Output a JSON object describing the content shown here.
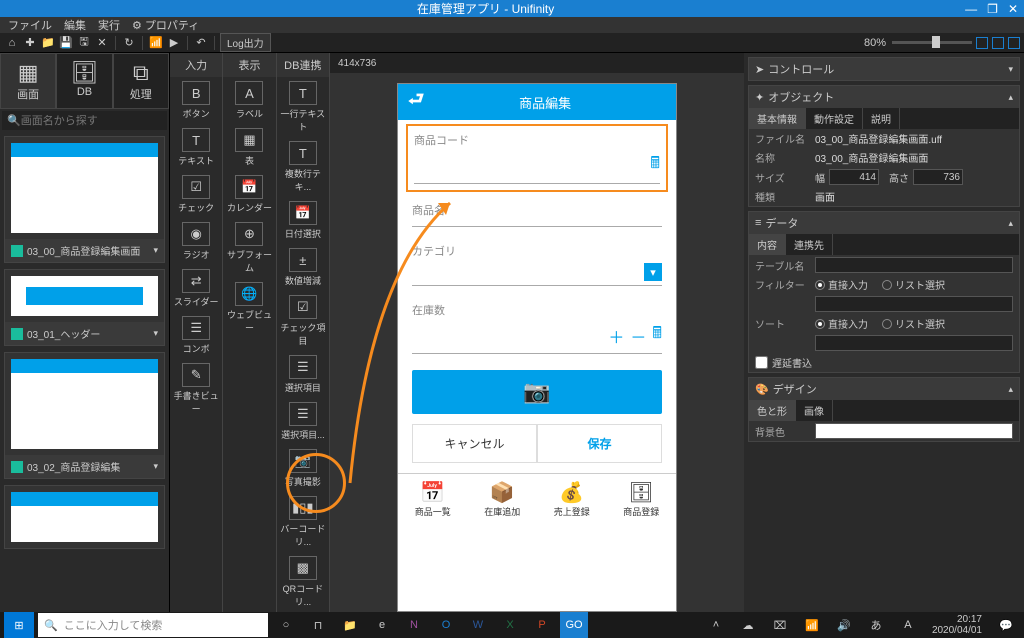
{
  "window": {
    "title": "在庫管理アプリ - Unifinity"
  },
  "menu": {
    "file": "ファイル",
    "edit": "編集",
    "run": "実行",
    "property": "⚙ プロパティ"
  },
  "toolbar": {
    "log": "Log出力",
    "zoom": "80%"
  },
  "left_tabs": {
    "screen": "画面",
    "db": "DB",
    "process": "処理"
  },
  "search": {
    "placeholder": "画面名から探す"
  },
  "thumbs": [
    {
      "label": "03_00_商品登録編集画面"
    },
    {
      "label": "03_01_ヘッダー"
    },
    {
      "label": "03_02_商品登録編集"
    }
  ],
  "palette": {
    "col1": {
      "header": "入力",
      "items": [
        "ボタン",
        "テキスト",
        "チェック",
        "ラジオ",
        "スライダー",
        "コンボ",
        "手書きビュー"
      ]
    },
    "col2": {
      "header": "表示",
      "items": [
        "ラベル",
        "表",
        "カレンダー",
        "サブフォーム",
        "ウェブビュー"
      ]
    },
    "col3": {
      "header": "DB連携",
      "items": [
        "一行テキスト",
        "複数行テキ...",
        "日付選択",
        "数値増減",
        "チェック項目",
        "選択項目",
        "選択項目...",
        "写真撮影",
        "バーコードリ...",
        "QRコードリ..."
      ]
    }
  },
  "canvas": {
    "size": "414x736"
  },
  "phone": {
    "header": "商品編集",
    "fields": {
      "code": "商品コード",
      "name": "商品名",
      "cat": "カテゴリ",
      "stock": "在庫数"
    },
    "buttons": {
      "cancel": "キャンセル",
      "save": "保存"
    },
    "nav": [
      "商品一覧",
      "在庫追加",
      "売上登録",
      "商品登録"
    ]
  },
  "props": {
    "control": "コントロール",
    "object": "オブジェクト",
    "tabs": {
      "basic": "基本情報",
      "action": "動作設定",
      "desc": "説明"
    },
    "rows": {
      "filename_l": "ファイル名",
      "filename_v": "03_00_商品登録編集画面.uff",
      "name_l": "名称",
      "name_v": "03_00_商品登録編集画面",
      "size_l": "サイズ",
      "w_l": "幅",
      "w_v": "414",
      "h_l": "高さ",
      "h_v": "736",
      "type_l": "種類",
      "type_v": "画面"
    },
    "data": {
      "title": "データ",
      "tabs": {
        "content": "内容",
        "link": "連携先"
      },
      "table_l": "テーブル名",
      "filter_l": "フィルター",
      "direct": "直接入力",
      "list": "リスト選択",
      "sort_l": "ソート",
      "defer_l": "遅延書込"
    },
    "design": {
      "title": "デザイン",
      "tabs": {
        "color": "色と形",
        "image": "画像"
      },
      "bg_l": "背景色"
    }
  },
  "taskbar": {
    "search_placeholder": "ここに入力して検索",
    "time": "20:17",
    "date": "2020/04/01"
  }
}
